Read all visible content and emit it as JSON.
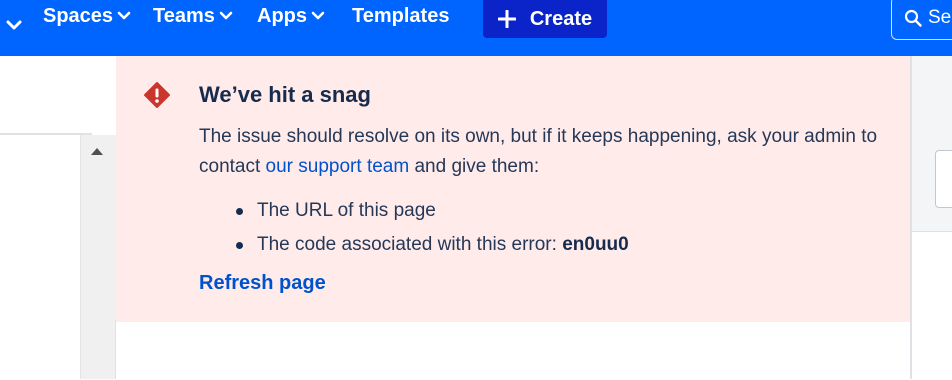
{
  "nav": {
    "items": [
      {
        "label": "Spaces"
      },
      {
        "label": "Teams"
      },
      {
        "label": "Apps"
      },
      {
        "label": "Templates"
      }
    ],
    "create_label": "Create",
    "search_text": "Se"
  },
  "error": {
    "title": "We’ve hit a snag",
    "body_before": "The issue should resolve on its own, but if it keeps happening, ask your admin to contact ",
    "support_link": "our support team",
    "body_after": " and give them:",
    "list": [
      {
        "text": "The URL of this page"
      },
      {
        "text": "The code associated with this error: ",
        "code": "en0uu0"
      }
    ],
    "refresh_label": "Refresh page"
  },
  "colors": {
    "nav_bg": "#0065ff",
    "create_bg": "#0a24c9",
    "error_bg": "#ffebe9",
    "error_icon": "#de350b",
    "link": "#0052cc"
  },
  "icons": {
    "nav_chevron": "chevron-down-icon",
    "create": "plus-icon",
    "search": "search-icon",
    "error": "error-diamond-icon",
    "scroll_up": "triangle-up-icon"
  }
}
